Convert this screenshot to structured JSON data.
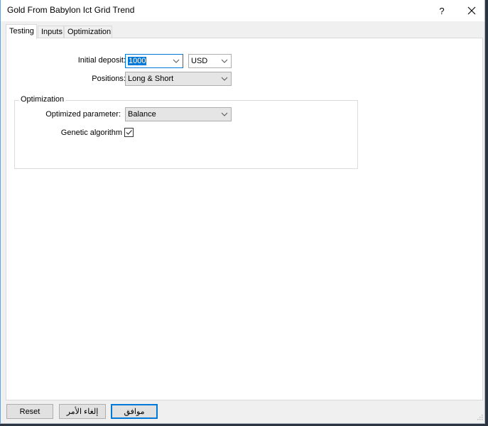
{
  "window": {
    "title": "Gold From Babylon Ict Grid Trend",
    "help_label": "?",
    "close_label": "✕"
  },
  "tabs": [
    {
      "label": "Testing",
      "active": true
    },
    {
      "label": "Inputs",
      "active": false
    },
    {
      "label": "Optimization",
      "active": false
    }
  ],
  "testing": {
    "initial_deposit_label": "Initial deposit:",
    "initial_deposit_value": "1000",
    "currency_value": "USD",
    "positions_label": "Positions:",
    "positions_value": "Long & Short",
    "optimization_group_title": "Optimization",
    "optimized_parameter_label": "Optimized parameter:",
    "optimized_parameter_value": "Balance",
    "genetic_algorithm_label": "Genetic algorithm",
    "genetic_algorithm_checked": true
  },
  "buttons": {
    "reset": "Reset",
    "cancel": "إلغاء الأمر",
    "ok": "موافق"
  },
  "colors": {
    "accent": "#0078d7",
    "window_bg": "#f0f0f0",
    "panel_bg": "#ffffff"
  }
}
